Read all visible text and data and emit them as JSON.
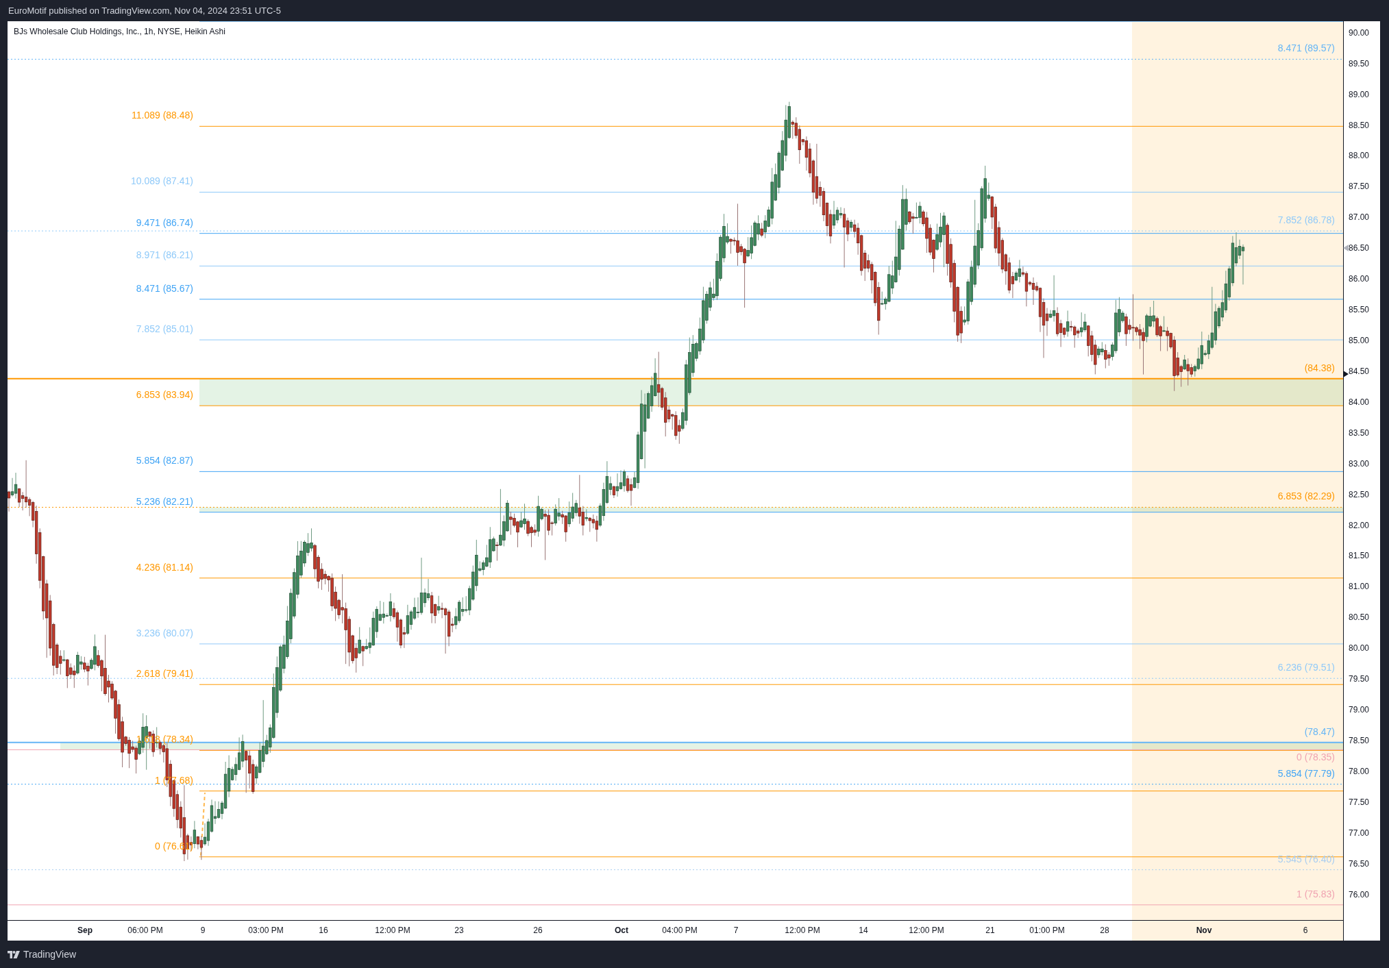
{
  "header": {
    "text": "EuroMotif published on TradingView.com, Nov 04, 2024 23:51 UTC-5"
  },
  "chart": {
    "legend": "BJs Wholesale Club Holdings, Inc., 1h, NYSE, Heikin Ashi",
    "fib_left": {
      "levels": [
        {
          "label": "11.089 (88.48)",
          "color": "#ff9800"
        },
        {
          "label": "10.089 (87.41)",
          "color": "#90caf9"
        },
        {
          "label": "9.471 (86.74)",
          "color": "#42a5f5"
        },
        {
          "label": "8.971 (86.21)",
          "color": "#90caf9"
        },
        {
          "label": "8.471 (85.67)",
          "color": "#42a5f5"
        },
        {
          "label": "7.852 (85.01)",
          "color": "#90caf9"
        },
        {
          "label": "6.853 (83.94)",
          "color": "#ff9800"
        },
        {
          "label": "5.854 (82.87)",
          "color": "#42a5f5"
        },
        {
          "label": "5.236 (82.21)",
          "color": "#42a5f5"
        },
        {
          "label": "4.236 (81.14)",
          "color": "#ff9800"
        },
        {
          "label": "3.236 (80.07)",
          "color": "#90caf9"
        },
        {
          "label": "2.618 (79.41)",
          "color": "#ff9800"
        },
        {
          "label": "1.618 (78.34)",
          "color": "#ff9800"
        },
        {
          "label": "1 (77.68)",
          "color": "#ff9800"
        },
        {
          "label": "0 (76.61)",
          "color": "#ff9800"
        }
      ]
    },
    "fib_right": {
      "levels": [
        {
          "label": "8.471 (89.57)",
          "color": "#64b5f6",
          "kind": "dotted"
        },
        {
          "label": "7.852 (86.78)",
          "color": "#90caf9",
          "kind": "dotted"
        },
        {
          "label": "(84.38)",
          "color": "#ff9800",
          "kind": "solid"
        },
        {
          "label": "6.853 (82.29)",
          "color": "#ff9800",
          "kind": "dotted"
        },
        {
          "label": "6.236 (79.51)",
          "color": "#90caf9",
          "kind": "dotted"
        },
        {
          "label": "(78.47)",
          "color": "#64b5f6",
          "kind": "solid"
        },
        {
          "label": "0 (78.35)",
          "color": "#f0a3b1",
          "kind": "solid"
        },
        {
          "label": "5.854 (77.79)",
          "color": "#42a5f5",
          "kind": "dotted"
        },
        {
          "label": "5.545 (76.40)",
          "color": "#a8cdf0",
          "kind": "dotted"
        },
        {
          "label": "1 (75.83)",
          "color": "#f0a3b1",
          "kind": "solid"
        }
      ]
    }
  },
  "price_axis": {
    "ticks": [
      "90.00",
      "89.50",
      "89.00",
      "88.50",
      "88.00",
      "87.50",
      "87.00",
      "86.50",
      "86.00",
      "85.50",
      "85.00",
      "84.50",
      "84.00",
      "83.50",
      "83.00",
      "82.50",
      "82.00",
      "81.50",
      "81.00",
      "80.50",
      "80.00",
      "79.50",
      "79.00",
      "78.50",
      "78.00",
      "77.50",
      "77.00",
      "76.50",
      "76.00"
    ]
  },
  "time_axis": {
    "ticks": [
      {
        "label": "Sep",
        "major": true
      },
      {
        "label": "06:00 PM",
        "major": false
      },
      {
        "label": "9",
        "major": false
      },
      {
        "label": "03:00 PM",
        "major": false
      },
      {
        "label": "16",
        "major": false
      },
      {
        "label": "12:00 PM",
        "major": false
      },
      {
        "label": "23",
        "major": false
      },
      {
        "label": "26",
        "major": false
      },
      {
        "label": "Oct",
        "major": true
      },
      {
        "label": "04:00 PM",
        "major": false
      },
      {
        "label": "7",
        "major": false
      },
      {
        "label": "12:00 PM",
        "major": false
      },
      {
        "label": "14",
        "major": false
      },
      {
        "label": "12:00 PM",
        "major": false
      },
      {
        "label": "21",
        "major": false
      },
      {
        "label": "01:00 PM",
        "major": false
      },
      {
        "label": "28",
        "major": false
      },
      {
        "label": "Nov",
        "major": true
      },
      {
        "label": "6",
        "major": false
      }
    ]
  },
  "footer": {
    "brand": "TradingView"
  }
}
